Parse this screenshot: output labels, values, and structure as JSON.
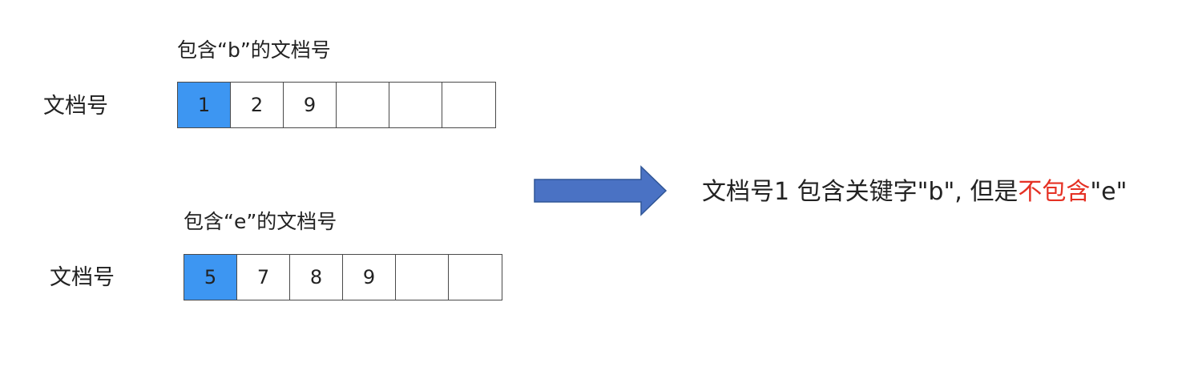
{
  "top": {
    "caption": "包含“b”的文档号",
    "row_label": "文档号",
    "cells": [
      "1",
      "2",
      "9",
      "",
      "",
      ""
    ],
    "highlight_index": 0
  },
  "bottom": {
    "caption": "包含“e”的文档号",
    "row_label": "文档号",
    "cells": [
      "5",
      "7",
      "8",
      "9",
      "",
      ""
    ],
    "highlight_index": 0
  },
  "result": {
    "part1": "文档号1 包含关键字\"b\", 但是",
    "negation": "不包含",
    "part2": "\"e\""
  },
  "colors": {
    "highlight": "#3d96f2",
    "arrow_fill": "#4a72c4",
    "arrow_stroke": "#2f5596",
    "negation": "#e53124"
  }
}
